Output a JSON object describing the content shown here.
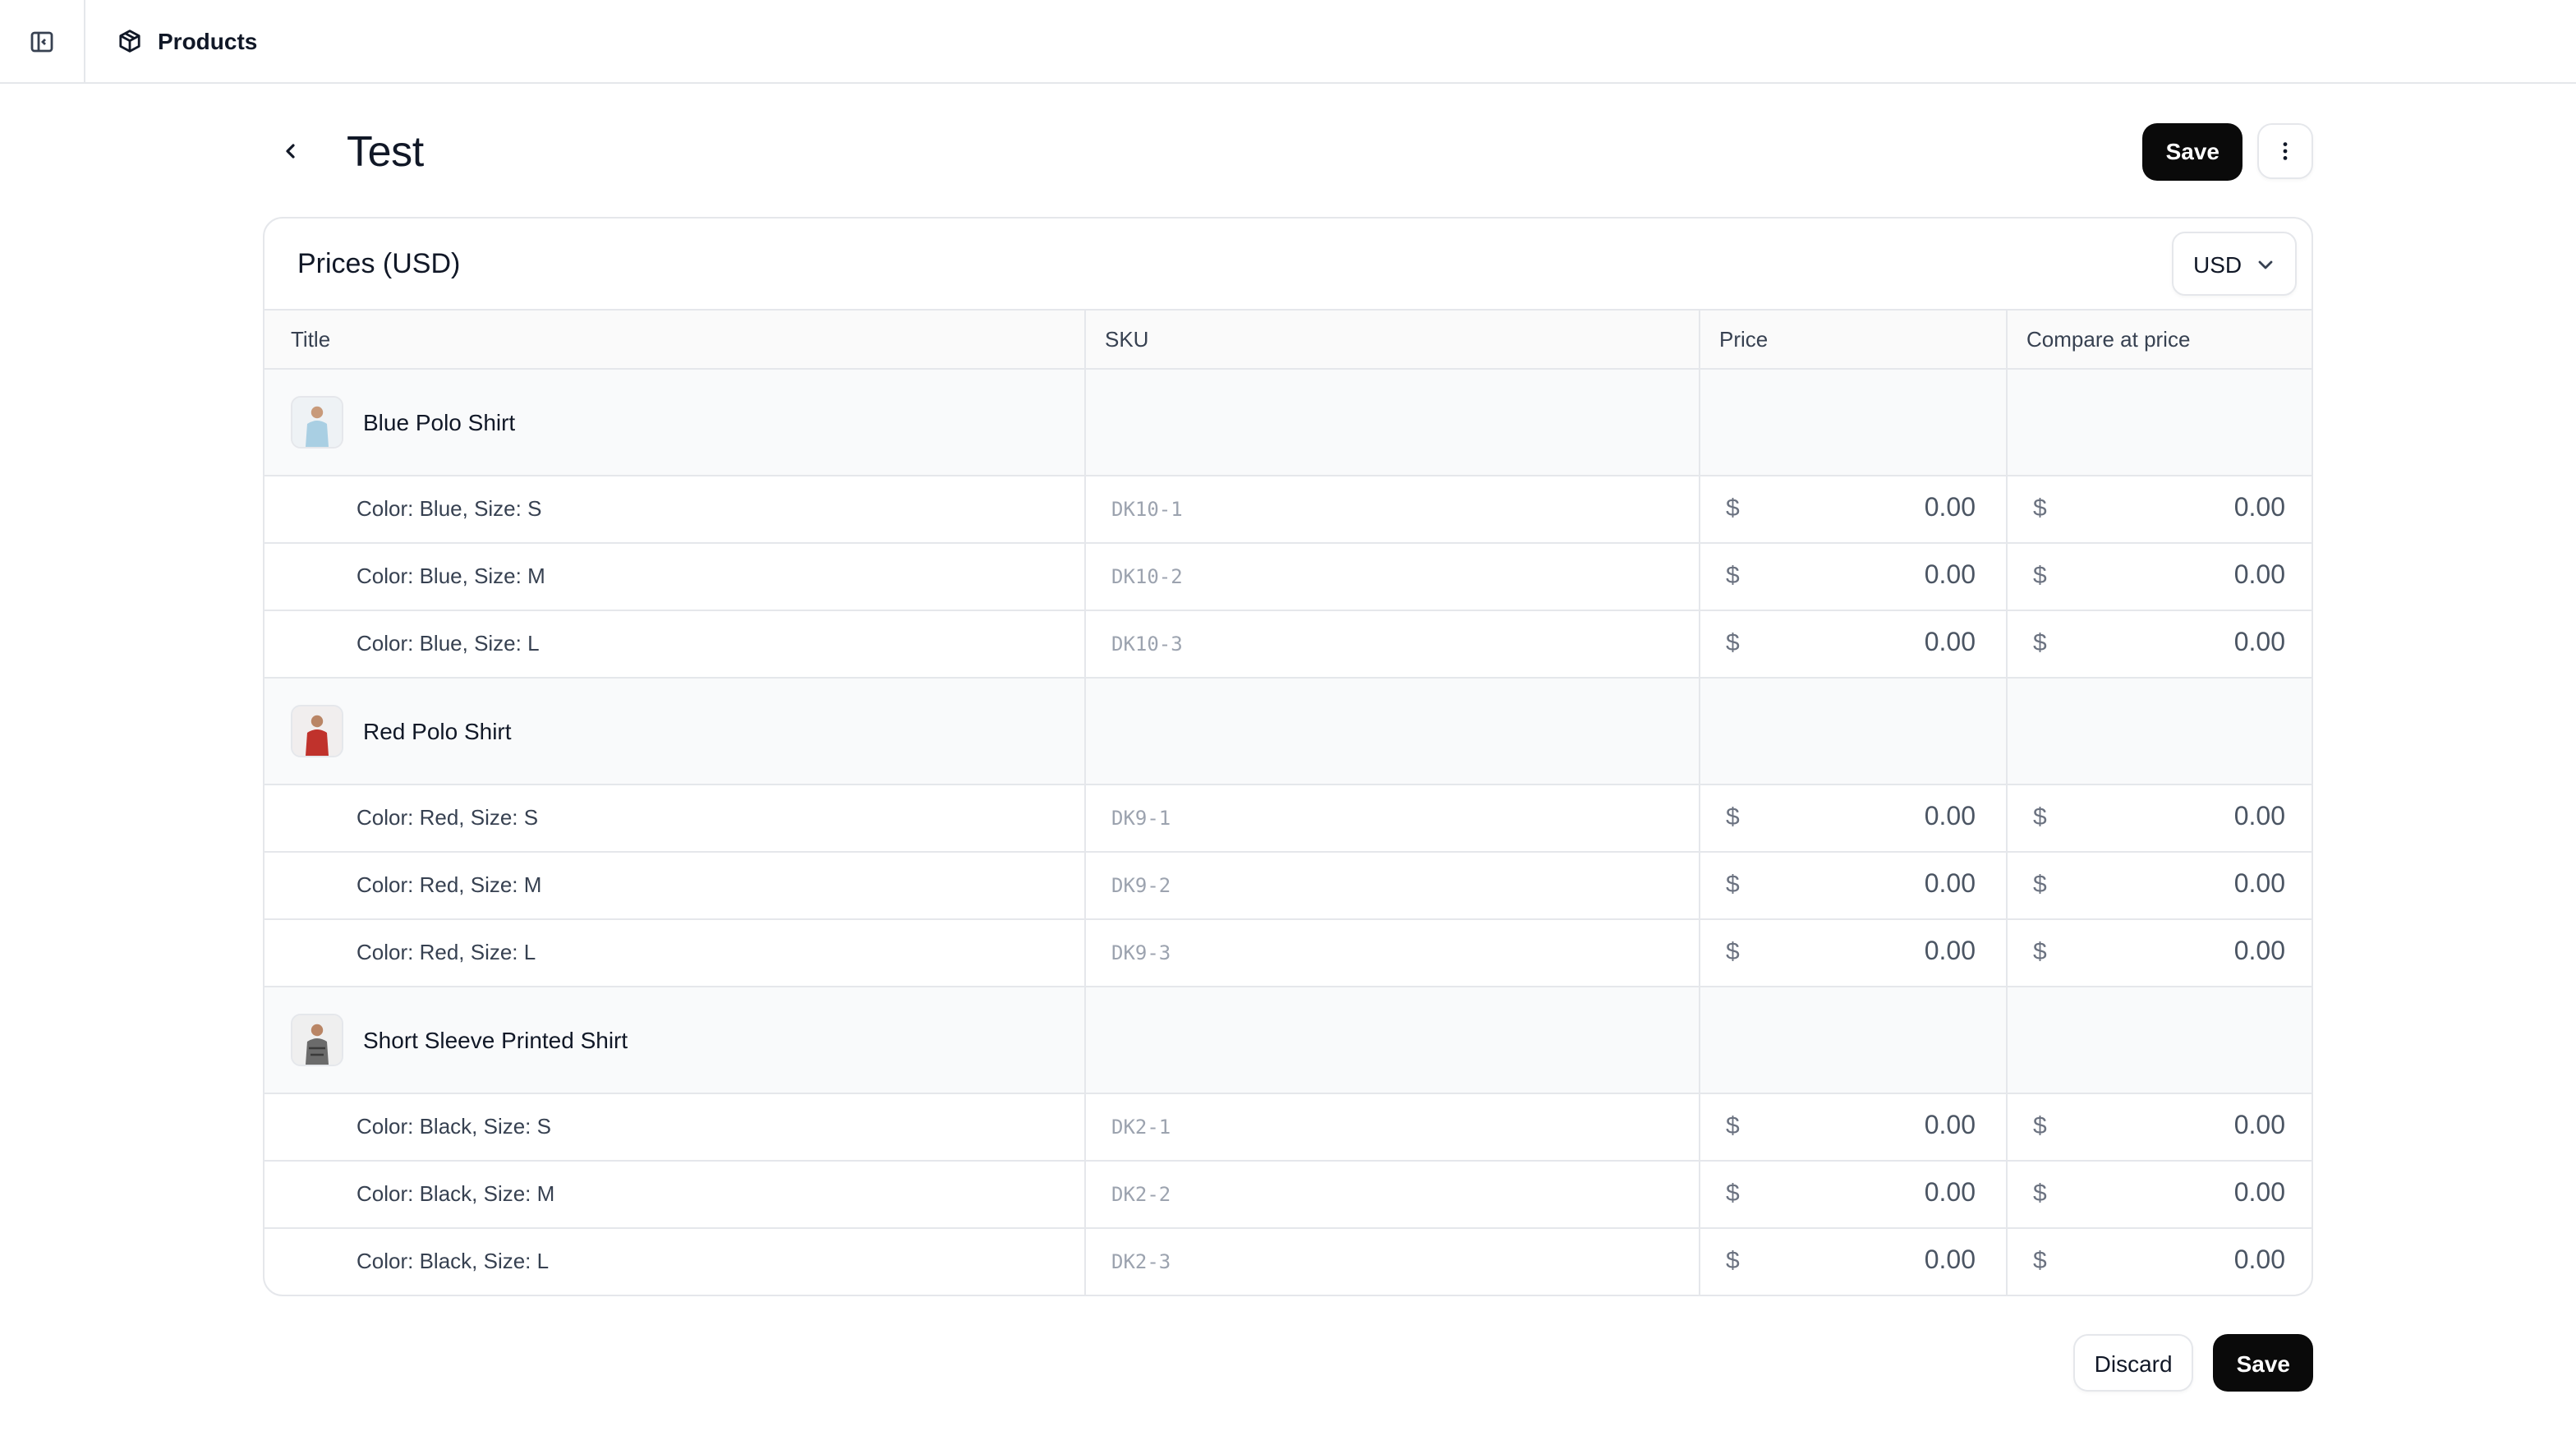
{
  "topbar": {
    "breadcrumb_label": "Products"
  },
  "header": {
    "title": "Test",
    "save_label": "Save"
  },
  "card": {
    "title": "Prices (USD)",
    "currency": "USD"
  },
  "table": {
    "columns": [
      "Title",
      "SKU",
      "Price",
      "Compare at price"
    ],
    "currency_symbol": "$",
    "groups": [
      {
        "name": "Blue Polo Shirt",
        "variants": [
          {
            "title": "Color: Blue, Size: S",
            "sku": "DK10-1",
            "price": "0.00",
            "compare": "0.00"
          },
          {
            "title": "Color: Blue, Size: M",
            "sku": "DK10-2",
            "price": "0.00",
            "compare": "0.00"
          },
          {
            "title": "Color: Blue, Size: L",
            "sku": "DK10-3",
            "price": "0.00",
            "compare": "0.00"
          }
        ]
      },
      {
        "name": "Red Polo Shirt",
        "variants": [
          {
            "title": "Color: Red, Size: S",
            "sku": "DK9-1",
            "price": "0.00",
            "compare": "0.00"
          },
          {
            "title": "Color: Red, Size: M",
            "sku": "DK9-2",
            "price": "0.00",
            "compare": "0.00"
          },
          {
            "title": "Color: Red, Size: L",
            "sku": "DK9-3",
            "price": "0.00",
            "compare": "0.00"
          }
        ]
      },
      {
        "name": "Short Sleeve Printed Shirt",
        "variants": [
          {
            "title": "Color: Black, Size: S",
            "sku": "DK2-1",
            "price": "0.00",
            "compare": "0.00"
          },
          {
            "title": "Color: Black, Size: M",
            "sku": "DK2-2",
            "price": "0.00",
            "compare": "0.00"
          },
          {
            "title": "Color: Black, Size: L",
            "sku": "DK2-3",
            "price": "0.00",
            "compare": "0.00"
          }
        ]
      }
    ]
  },
  "footer": {
    "discard_label": "Discard",
    "save_label": "Save"
  },
  "colors": {
    "primary_button": "#0a0a0a",
    "border": "#e5e7eb",
    "group_row_bg": "#f9fafb",
    "sku_text": "#9ca3af"
  }
}
